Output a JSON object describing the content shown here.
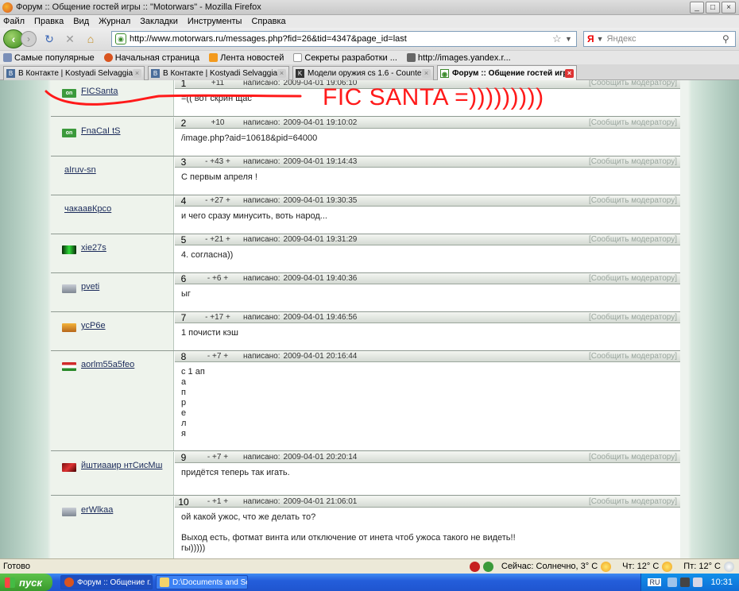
{
  "window": {
    "title": "Форум :: Общение гостей игры :: \"Motorwars\" - Mozilla Firefox",
    "minimize": "_",
    "maximize": "□",
    "close": "×"
  },
  "menu": [
    "Файл",
    "Правка",
    "Вид",
    "Журнал",
    "Закладки",
    "Инструменты",
    "Справка"
  ],
  "nav": {
    "back": "‹",
    "forward": "›",
    "reload": "↻",
    "stop": "✕",
    "home": "⌂",
    "url": "http://www.motorwars.ru/messages.php?fid=26&tid=4347&page_id=last",
    "search_engine": "Я",
    "search_placeholder": "Яндекс"
  },
  "bookmarks": [
    {
      "label": "Самые популярные",
      "icon": "page-icon",
      "color": "#7a8fb8"
    },
    {
      "label": "Начальная страница",
      "icon": "firefox-icon",
      "color": "#d9541f"
    },
    {
      "label": "Лента новостей",
      "icon": "rss-icon",
      "color": "#f39a1e"
    },
    {
      "label": "Секреты разработки ...",
      "icon": "page-icon",
      "color": "#ffffff"
    },
    {
      "label": "http://images.yandex.r...",
      "icon": "image-icon",
      "color": "#666666"
    }
  ],
  "tabs": [
    {
      "label": "В Контакте | Kostyadi Selvaggia",
      "icon": "vk-icon",
      "color": "#4a6d9a",
      "active": false
    },
    {
      "label": "В Контакте | Kostyadi Selvaggia",
      "icon": "vk-icon",
      "color": "#4a6d9a",
      "active": false
    },
    {
      "label": "Модели оружия cs 1.6 - Counter-Strike ...",
      "icon": "cs-icon",
      "color": "#333333",
      "active": false
    },
    {
      "label": "Форум :: Общение гостей игры...",
      "icon": "site-icon",
      "color": "#3a8a2a",
      "active": true
    }
  ],
  "post_labels": {
    "written": "написано:",
    "report": "[Сообщить модератору]",
    "online": "on"
  },
  "posts": [
    {
      "num": "1",
      "rating": "+11",
      "date": "2009-04-01 19:06:10",
      "nick": "FICSanta",
      "avatar": "online-badge",
      "body": "=(( вот скрин щас"
    },
    {
      "num": "2",
      "rating": "+10",
      "date": "2009-04-01 19:10:02",
      "nick": "FnaCaI tS",
      "avatar": "online-badge",
      "body": "/image.php?aid=10618&pid=64000"
    },
    {
      "num": "3",
      "rating": "- +43 +",
      "date": "2009-04-01 19:14:43",
      "nick": "aIruv-sn",
      "avatar": "none",
      "body": "С первым апреля !"
    },
    {
      "num": "4",
      "rating": "- +27 +",
      "date": "2009-04-01 19:30:35",
      "nick": "чакаавКрсо",
      "avatar": "none",
      "body": "и чего сразу минусить, воть народ..."
    },
    {
      "num": "5",
      "rating": "- +21 +",
      "date": "2009-04-01 19:31:29",
      "nick": "xie27s",
      "avatar": "matrix-avatar",
      "body": "4. согласна))"
    },
    {
      "num": "6",
      "rating": "- +6 +",
      "date": "2009-04-01 19:40:36",
      "nick": "pveti",
      "avatar": "grey-avatar",
      "body": "ыг"
    },
    {
      "num": "7",
      "rating": "- +17 +",
      "date": "2009-04-01 19:46:56",
      "nick": "ycP6e",
      "avatar": "orange-avatar",
      "body": "1 почисти кэш"
    },
    {
      "num": "8",
      "rating": "- +7 +",
      "date": "2009-04-01 20:16:44",
      "nick": "aorlm55a5feo",
      "avatar": "flag-avatar",
      "body": "с 1 ап\nа\nп\nр\nе\nл\nя"
    },
    {
      "num": "9",
      "rating": "- +7 +",
      "date": "2009-04-01 20:20:14",
      "nick": "йштиааир нтСисМш",
      "avatar": "red-avatar",
      "body": "придётся теперь так игать."
    },
    {
      "num": "10",
      "rating": "- +1 +",
      "date": "2009-04-01 21:06:01",
      "nick": "erWlkaa",
      "avatar": "grey-avatar",
      "body": "ой какой ужос, что же делать то?\n\nВыход есть, фотмат винта или отключение от инета чтоб ужоса такого не видеть!!\nгы)))))"
    }
  ],
  "annotation": {
    "text": "FIC SANTA =)))))))))",
    "color": "#ff1a1a"
  },
  "status": {
    "text": "Готово",
    "weather_now": "Сейчас: Солнечно, 3° C",
    "weather_thu": "Чт: 12° C",
    "weather_fri": "Пт: 12° C"
  },
  "taskbar": {
    "start": "пуск",
    "tasks": [
      {
        "label": "Форум :: Общение г...",
        "icon": "firefox-icon",
        "active": true
      },
      {
        "label": "D:\\Documents and Se...",
        "icon": "folder-icon",
        "active": false
      }
    ],
    "lang": "RU",
    "time": "10:31"
  }
}
